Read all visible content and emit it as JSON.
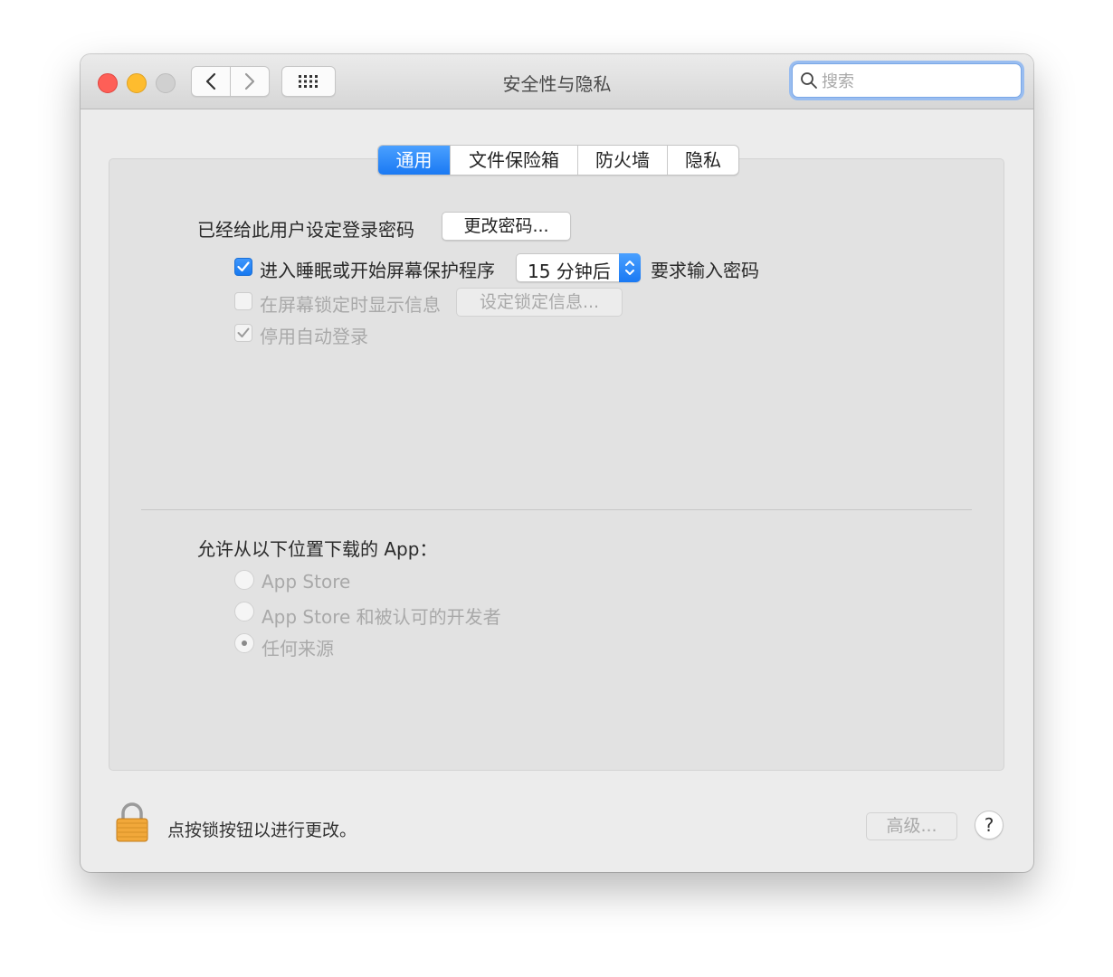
{
  "window": {
    "title": "安全性与隐私"
  },
  "search": {
    "placeholder": "搜索"
  },
  "tabs": [
    {
      "label": "通用",
      "active": true
    },
    {
      "label": "文件保险箱",
      "active": false
    },
    {
      "label": "防火墙",
      "active": false
    },
    {
      "label": "隐私",
      "active": false
    }
  ],
  "general": {
    "password_text": "已经给此用户设定登录密码",
    "change_password_label": "更改密码...",
    "require_password": {
      "label": "进入睡眠或开始屏幕保护程序",
      "checked": true,
      "delay_value": "15 分钟后",
      "suffix": "要求输入密码"
    },
    "lock_message": {
      "label": "在屏幕锁定时显示信息",
      "checked": false,
      "button_label": "设定锁定信息..."
    },
    "disable_auto_login": {
      "label": "停用自动登录",
      "checked": true
    }
  },
  "downloads": {
    "heading": "允许从以下位置下载的 App：",
    "options": [
      {
        "label": "App Store",
        "selected": false
      },
      {
        "label": "App Store 和被认可的开发者",
        "selected": false
      },
      {
        "label": "任何来源",
        "selected": true
      }
    ]
  },
  "footer": {
    "lock_text": "点按锁按钮以进行更改。",
    "advanced_label": "高级...",
    "help_label": "?"
  },
  "colors": {
    "accent": "#1a79f3",
    "close": "#fe5f57",
    "minimize": "#febc2e"
  }
}
